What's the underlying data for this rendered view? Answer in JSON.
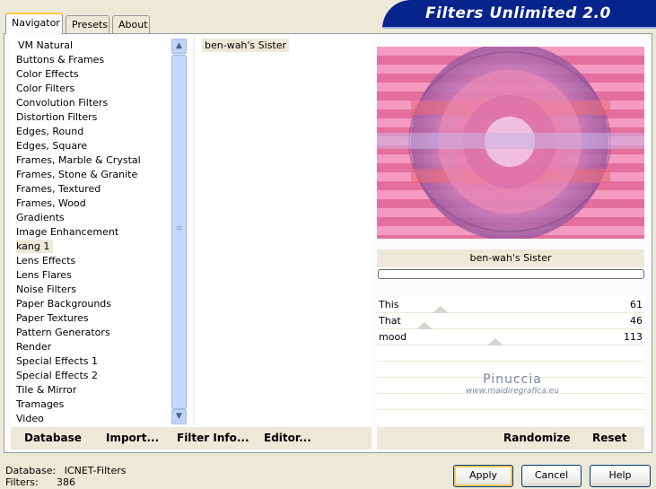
{
  "title": "Filters Unlimited 2.0",
  "tabs": [
    {
      "label": "Navigator",
      "active": true
    },
    {
      "label": "Presets",
      "active": false
    },
    {
      "label": "About",
      "active": false
    }
  ],
  "categories": [
    "VM Natural",
    "Buttons & Frames",
    "Color Effects",
    "Color Filters",
    "Convolution Filters",
    "Distortion Filters",
    "Edges, Round",
    "Edges, Square",
    "Frames, Marble & Crystal",
    "Frames, Stone & Granite",
    "Frames, Textured",
    "Frames, Wood",
    "Gradients",
    "Image Enhancement",
    "kang 1",
    "Lens Effects",
    "Lens Flares",
    "Noise Filters",
    "Paper Backgrounds",
    "Paper Textures",
    "Pattern Generators",
    "Render",
    "Special Effects 1",
    "Special Effects 2",
    "Tile & Mirror",
    "Tramages",
    "Video"
  ],
  "selected_category": "kang 1",
  "filters": [
    "ben-wah's Sister"
  ],
  "preview": {
    "filter_name": "ben-wah's Sister"
  },
  "params": [
    {
      "name": "This",
      "value": 61
    },
    {
      "name": "That",
      "value": 46
    },
    {
      "name": "mood",
      "value": 113
    }
  ],
  "watermark": {
    "line1": "Pinuccia",
    "line2": "www.maidiregrafica.eu"
  },
  "left_buttons": {
    "database": "Database",
    "import": "Import...",
    "filter_info": "Filter Info...",
    "editor": "Editor..."
  },
  "right_buttons": {
    "randomize": "Randomize",
    "reset": "Reset"
  },
  "status": {
    "database_label": "Database:",
    "database_value": "ICNET-Filters",
    "filters_label": "Filters:",
    "filters_value": "386"
  },
  "dialog_buttons": {
    "apply": "Apply",
    "cancel": "Cancel",
    "help": "Help"
  },
  "colors": {
    "banner": "#07238c",
    "preview_bg": "#f58fb4",
    "accent": "#ffc83c"
  }
}
